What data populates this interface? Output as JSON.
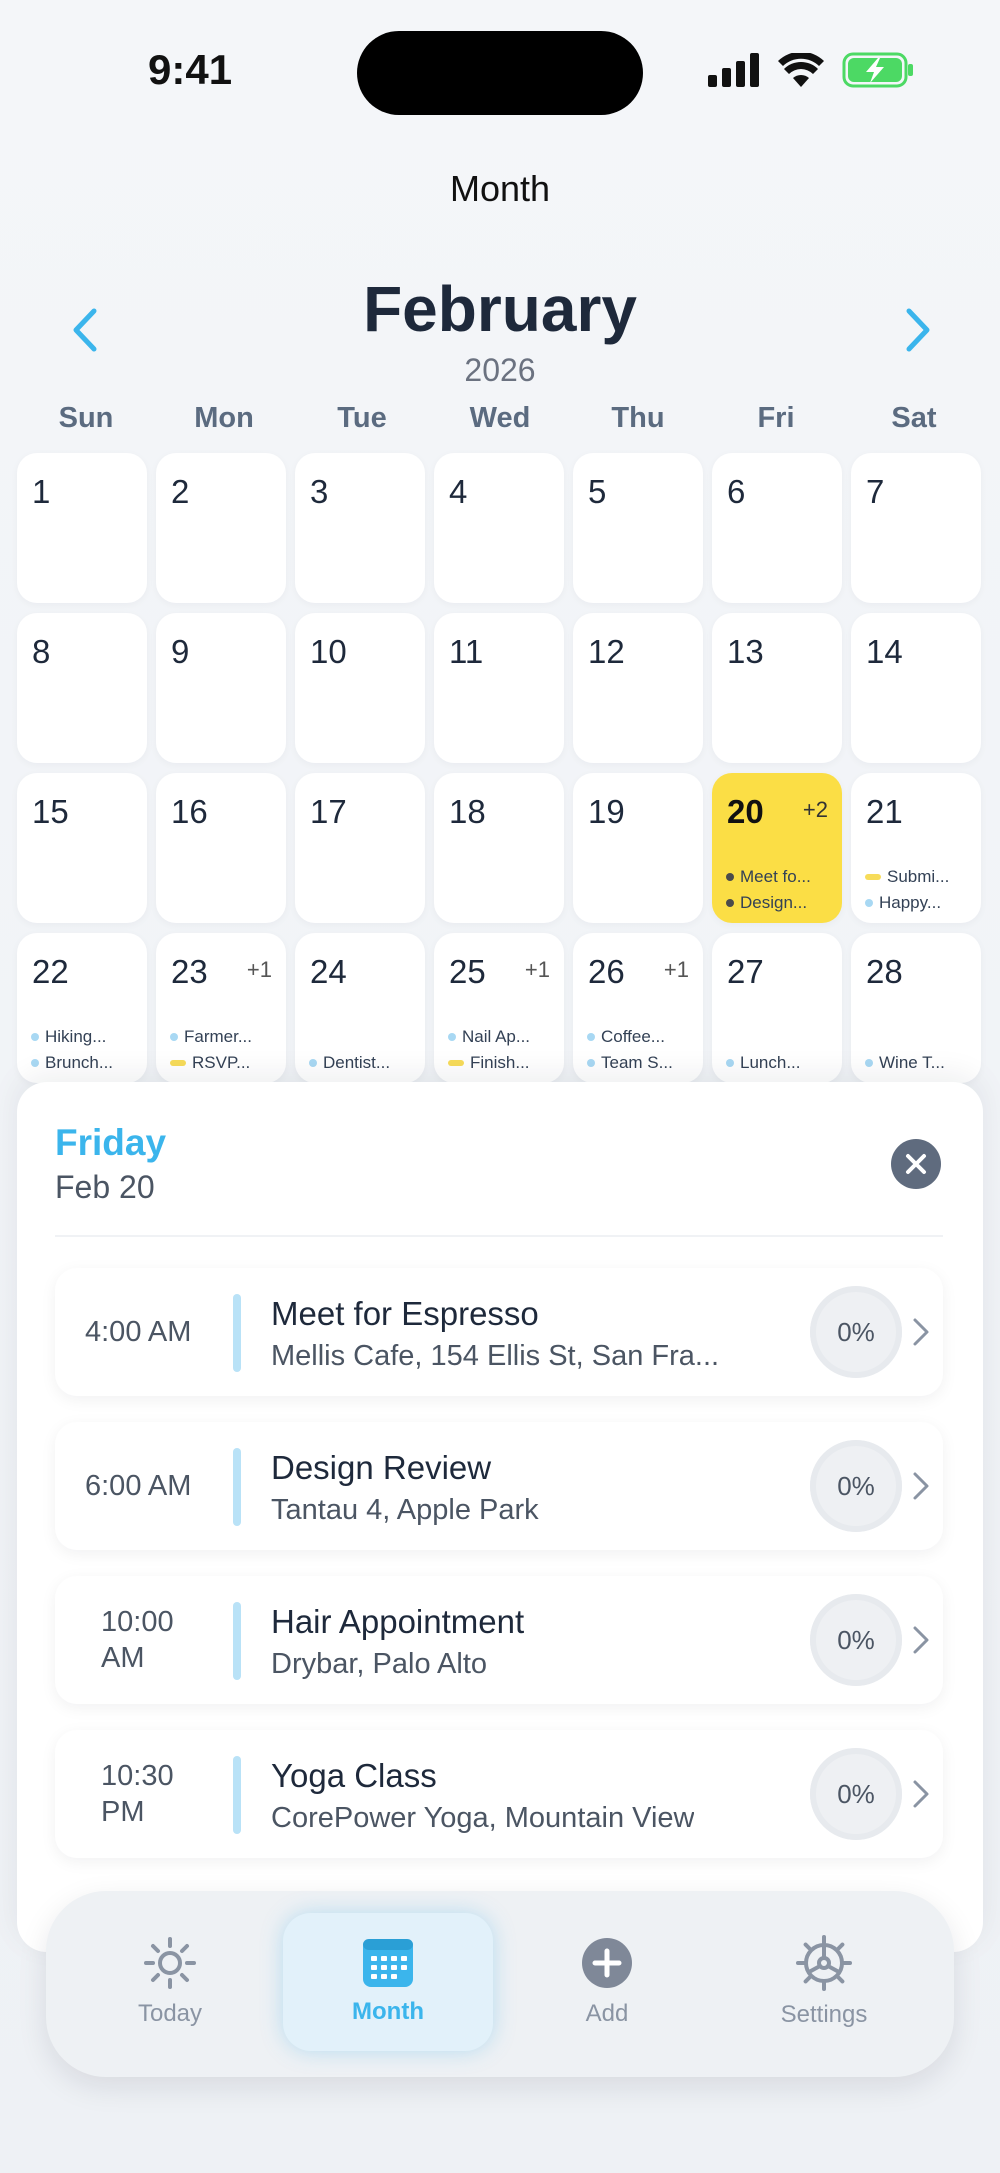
{
  "status": {
    "time": "9:41"
  },
  "header": {
    "title": "Month"
  },
  "calendar": {
    "month": "February",
    "year": "2026",
    "weekdays": [
      "Sun",
      "Mon",
      "Tue",
      "Wed",
      "Thu",
      "Fri",
      "Sat"
    ],
    "days": {
      "d1": "1",
      "d2": "2",
      "d3": "3",
      "d4": "4",
      "d5": "5",
      "d6": "6",
      "d7": "7",
      "d8": "8",
      "d9": "9",
      "d10": "10",
      "d11": "11",
      "d12": "12",
      "d13": "13",
      "d14": "14",
      "d15": "15",
      "d16": "16",
      "d17": "17",
      "d18": "18",
      "d19": "19",
      "d20": "20",
      "d21": "21",
      "d22": "22",
      "d23": "23",
      "d24": "24",
      "d25": "25",
      "d26": "26",
      "d27": "27",
      "d28": "28"
    },
    "more": {
      "d20": "+2",
      "d23": "+1",
      "d25": "+1",
      "d26": "+1"
    },
    "events": {
      "d20": [
        "Meet fo...",
        "Design..."
      ],
      "d21": [
        "Submi...",
        "Happy..."
      ],
      "d22": [
        "Hiking...",
        "Brunch..."
      ],
      "d23": [
        "Farmer...",
        "RSVP..."
      ],
      "d24": [
        "Dentist..."
      ],
      "d25": [
        "Nail Ap...",
        "Finish..."
      ],
      "d26": [
        "Coffee...",
        "Team S..."
      ],
      "d27": [
        "Lunch..."
      ],
      "d28": [
        "Wine T..."
      ]
    }
  },
  "detail": {
    "day": "Friday",
    "date": "Feb 20",
    "events": [
      {
        "time": "4:00 AM",
        "title": "Meet for Espresso",
        "location": "Mellis Cafe, 154 Ellis St, San Fra...",
        "progress": "0%"
      },
      {
        "time": "6:00 AM",
        "title": "Design Review",
        "location": "Tantau 4, Apple Park",
        "progress": "0%"
      },
      {
        "time": "10:00 AM",
        "title": "Hair Appointment",
        "location": "Drybar, Palo Alto",
        "progress": "0%"
      },
      {
        "time": "10:30 PM",
        "title": "Yoga Class",
        "location": "CorePower Yoga, Mountain View",
        "progress": "0%"
      }
    ]
  },
  "tabs": [
    {
      "label": "Today",
      "icon": "sun-icon"
    },
    {
      "label": "Month",
      "icon": "calendar-icon"
    },
    {
      "label": "Add",
      "icon": "plus-circle-icon"
    },
    {
      "label": "Settings",
      "icon": "gear-icon"
    }
  ],
  "colors": {
    "accent": "#3bb5ec",
    "today_highlight": "#fbde45",
    "text_dark": "#1e293b"
  }
}
